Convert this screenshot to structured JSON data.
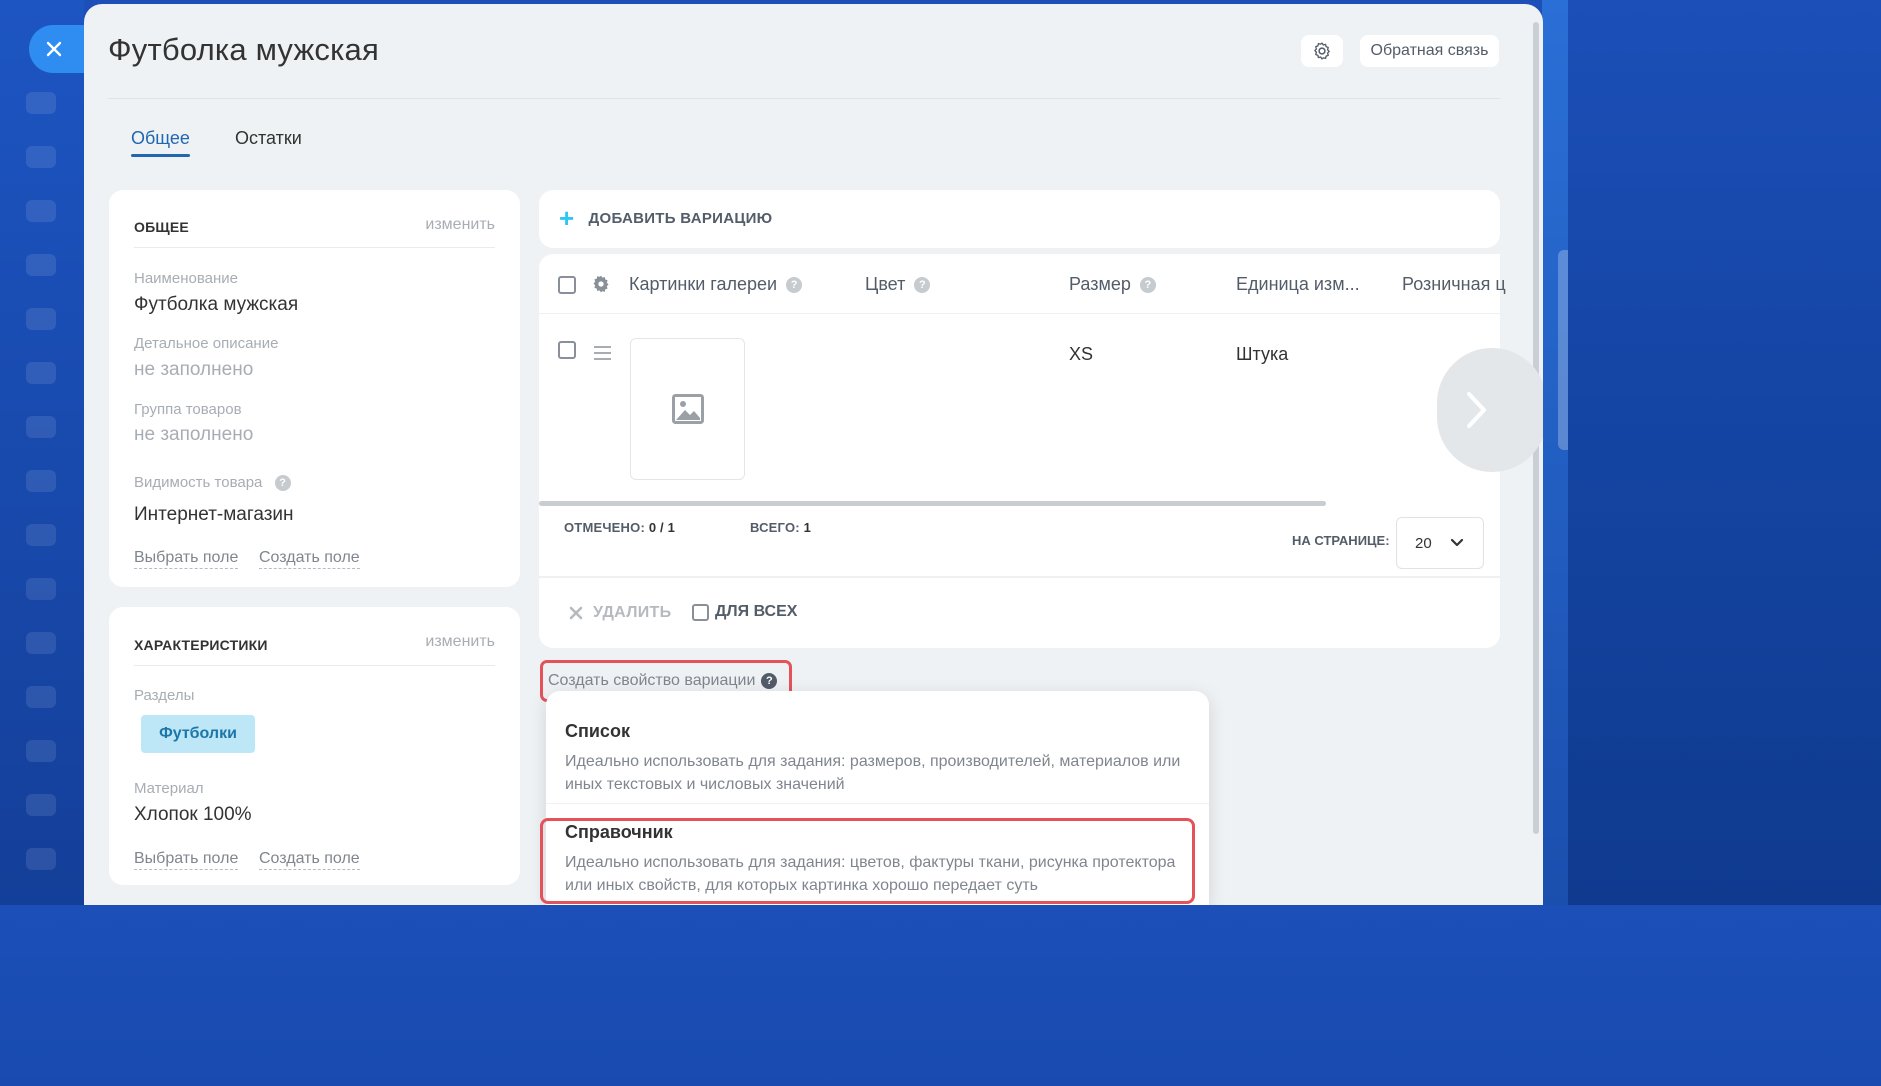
{
  "window": {
    "title": "Футболка мужская",
    "feedback_label": "Обратная связь",
    "settings_icon": "gear-icon",
    "close_icon": "close-icon"
  },
  "tabs": [
    {
      "label": "Общее",
      "active": true
    },
    {
      "label": "Остатки",
      "active": false
    }
  ],
  "general_card": {
    "title": "ОБЩЕЕ",
    "edit_label": "изменить",
    "fields": [
      {
        "label": "Наименование",
        "value": "Футболка мужская"
      },
      {
        "label": "Детальное описание",
        "value": "не заполнено"
      },
      {
        "label": "Группа товаров",
        "value": "не заполнено"
      },
      {
        "label": "Видимость товара",
        "value": "Интернет-магазин"
      }
    ],
    "select_field": "Выбрать поле",
    "create_field": "Создать поле"
  },
  "chars_card": {
    "title": "ХАРАКТЕРИСТИКИ",
    "edit_label": "изменить",
    "sections_label": "Разделы",
    "section_tag": "Футболки",
    "material_label": "Материал",
    "material_value": "Хлопок 100%",
    "select_field": "Выбрать поле",
    "create_field": "Создать поле"
  },
  "variations": {
    "add_label": "ДОБАВИТЬ ВАРИАЦИЮ",
    "columns": [
      "Картинки галереи",
      "Цвет",
      "Размер",
      "Единица изм...",
      "Розничная ц"
    ],
    "rows": [
      {
        "size": "XS",
        "unit": "Штука"
      }
    ],
    "selected_label": "ОТМЕЧЕНО:",
    "selected_value": "0 / 1",
    "total_label": "ВСЕГО:",
    "total_value": "1",
    "per_page_label": "НА СТРАНИЦЕ:",
    "per_page_value": "20",
    "delete_label": "УДАЛИТЬ",
    "for_all_label": "ДЛЯ ВСЕХ"
  },
  "create_property": {
    "label": "Создать свойство вариации",
    "options": [
      {
        "title": "Список",
        "description": "Идеально использовать для задания: размеров, производителей, материалов или иных текстовых и числовых значений"
      },
      {
        "title": "Справочник",
        "description": "Идеально использовать для задания: цветов, фактуры ткани, рисунка протектора или иных свойств, для которых картинка хорошо передает суть"
      }
    ]
  },
  "colors": {
    "accent": "#2067b0",
    "highlight": "#e4525a",
    "plus": "#2fc6f6",
    "tag_bg": "#bde6f6"
  }
}
